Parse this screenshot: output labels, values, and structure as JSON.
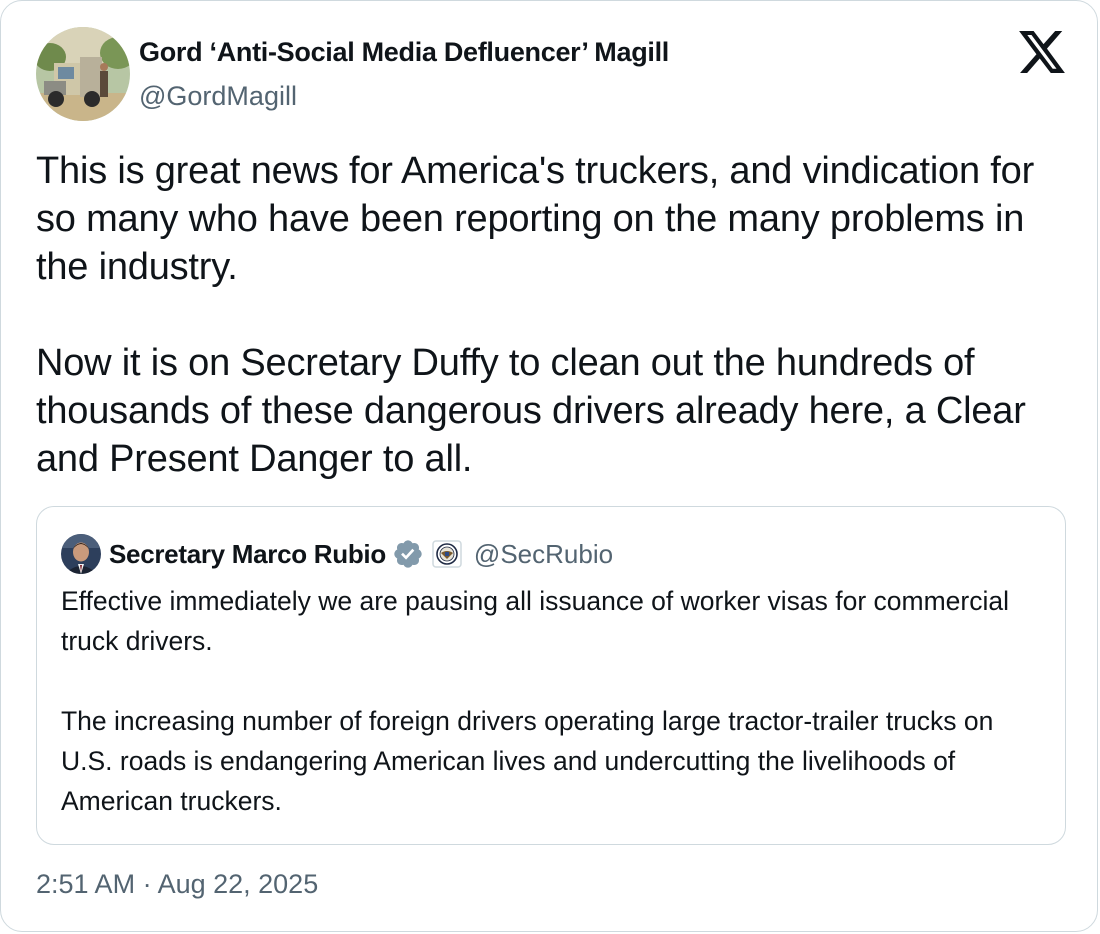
{
  "tweet": {
    "author_name": "Gord ‘Anti-Social Media Defluencer’ Magill",
    "author_handle": "@GordMagill",
    "paragraphs": [
      "This is great news for America's truckers, and vindication for so many who have been reporting on the many problems in the industry.",
      "Now it is on Secretary Duffy to clean out the hundreds of thousands of these dangerous drivers already here, a Clear and Present Danger to all."
    ],
    "timestamp": "2:51 AM · Aug 22, 2025"
  },
  "quoted": {
    "author_name": "Secretary Marco Rubio",
    "author_handle": "@SecRubio",
    "paragraphs": [
      "Effective immediately we are pausing all issuance of worker visas for commercial truck drivers.",
      "The increasing number of foreign drivers operating large tractor-trailer trucks on U.S. roads is endangering American lives and undercutting the livelihoods of American truckers."
    ],
    "verified_color": "#829aab"
  },
  "icons": {
    "logo": "x-logo-icon",
    "verified": "verified-badge-icon",
    "affiliation": "state-department-seal-icon"
  }
}
